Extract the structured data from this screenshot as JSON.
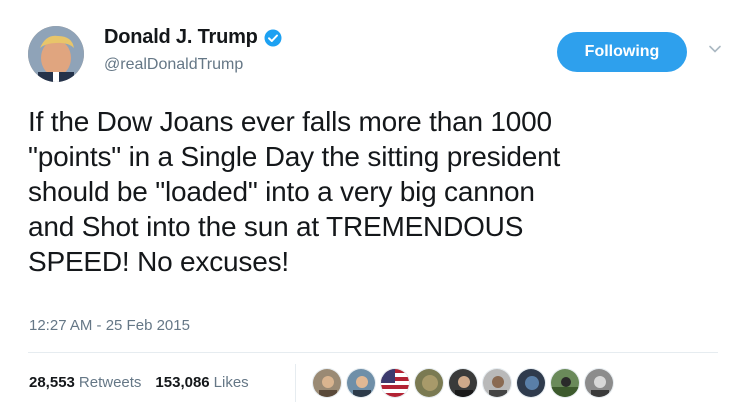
{
  "tweet": {
    "author": {
      "display_name": "Donald J. Trump",
      "handle": "@realDonaldTrump",
      "verified": true,
      "avatar_icon": "profile-photo"
    },
    "follow_button_label": "Following",
    "menu_icon": "chevron-down-icon",
    "text": "If the Dow Joans ever falls more than 1000\n\"points\" in a Single Day the sitting president\nshould be \"loaded\" into a very big cannon\nand Shot into the sun at TREMENDOUS\nSPEED! No excuses!",
    "timestamp": "12:27 AM - 25 Feb 2015",
    "stats": {
      "retweets_count": "28,553",
      "retweets_label": "Retweets",
      "likes_count": "153,086",
      "likes_label": "Likes"
    }
  },
  "colors": {
    "accent": "#2ea0ed",
    "text": "#14171a",
    "muted": "#657786",
    "divider": "#e6ecf0"
  }
}
